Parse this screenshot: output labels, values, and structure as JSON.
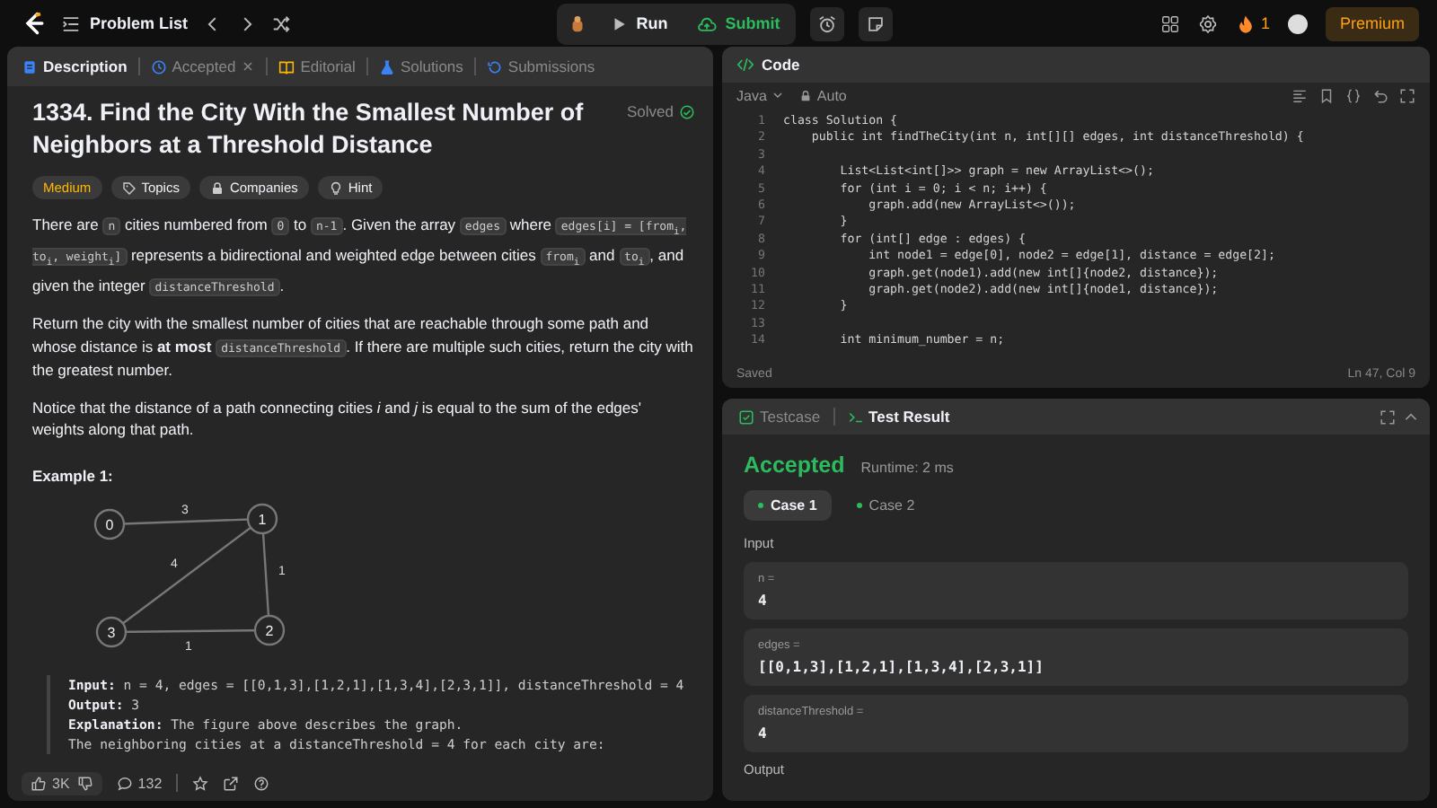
{
  "topbar": {
    "nav_title": "Problem List",
    "run_label": "Run",
    "submit_label": "Submit",
    "streak": "1",
    "premium": "Premium"
  },
  "description_panel": {
    "tabs": [
      {
        "label": "Description",
        "selected": true,
        "closable": false,
        "color": "#3c82f6"
      },
      {
        "label": "Accepted",
        "selected": false,
        "closable": true,
        "color": "#3c82f6"
      },
      {
        "label": "Editorial",
        "selected": false,
        "closable": false,
        "color": "#ffb700"
      },
      {
        "label": "Solutions",
        "selected": false,
        "closable": false,
        "color": "#3c82f6"
      },
      {
        "label": "Submissions",
        "selected": false,
        "closable": false,
        "color": "#3c82f6"
      }
    ],
    "title": "1334. Find the City With the Smallest Number of Neighbors at a Threshold Distance",
    "status": "Solved",
    "tags": [
      {
        "label": "Medium",
        "kind": "difficulty"
      },
      {
        "label": "Topics",
        "kind": "topics"
      },
      {
        "label": "Companies",
        "kind": "companies"
      },
      {
        "label": "Hint",
        "kind": "hint"
      }
    ],
    "paragraphs": [
      [
        {
          "kind": "text",
          "text": "There are "
        },
        {
          "kind": "code",
          "text": "n"
        },
        {
          "kind": "text",
          "text": " cities numbered from "
        },
        {
          "kind": "code",
          "text": "0"
        },
        {
          "kind": "text",
          "text": " to "
        },
        {
          "kind": "code",
          "text": "n-1"
        },
        {
          "kind": "text",
          "text": ". Given the array "
        },
        {
          "kind": "code",
          "text": "edges"
        },
        {
          "kind": "text",
          "text": " where "
        },
        {
          "kind": "code",
          "text": "edges[i] = [from$_{i}$, to$_{i}$, weight$_{i}$]"
        },
        {
          "kind": "text",
          "text": " represents a bidirectional and weighted edge between cities "
        },
        {
          "kind": "code",
          "text": "from$_{i}$"
        },
        {
          "kind": "text",
          "text": " and "
        },
        {
          "kind": "code",
          "text": "to$_{i}$"
        },
        {
          "kind": "text",
          "text": ", and given the integer "
        },
        {
          "kind": "code",
          "text": "distanceThreshold"
        },
        {
          "kind": "text",
          "text": "."
        }
      ],
      [
        {
          "kind": "text",
          "text": "Return the city with the smallest number of cities that are reachable through some path and whose distance is **at most** "
        },
        {
          "kind": "code",
          "text": "distanceThreshold"
        },
        {
          "kind": "text",
          "text": ". If there are multiple such cities, return the city with the greatest number."
        }
      ],
      [
        {
          "kind": "text",
          "text": "Notice that the distance of a path connecting cities *i* and *j* is equal to the sum of the edges' weights along that path."
        }
      ]
    ],
    "example_title": "Example 1:",
    "graph": {
      "nodes": [
        "0",
        "1",
        "3",
        "2"
      ],
      "edges": [
        {
          "weight": "3"
        },
        {
          "weight": "4"
        },
        {
          "weight": "1"
        },
        {
          "weight": "1"
        }
      ]
    },
    "example_lines": [
      "**Input:** n = 4, edges = [[0,1,3],[1,2,1],[1,3,4],[2,3,1]], distanceThreshold = 4",
      "**Output:** 3",
      "**Explanation:** The figure above describes the graph.",
      "The neighboring cities at a distanceThreshold = 4 for each city are:"
    ],
    "footer": {
      "likes": "3K",
      "comments": "132"
    }
  },
  "code_panel": {
    "title": "Code",
    "language": "Java",
    "mode": "Auto",
    "lines": [
      {
        "number": "1",
        "text": "class Solution {"
      },
      {
        "number": "2",
        "text": "    public int findTheCity(int n, int[][] edges, int distanceThreshold) {"
      },
      {
        "number": "3"
      },
      {
        "number": "4",
        "text": "        List<List<int[]>> graph = new ArrayList<>();"
      },
      {
        "number": "5",
        "text": "        for (int i = 0; i < n; i++) {"
      },
      {
        "number": "6",
        "text": "            graph.add(new ArrayList<>());"
      },
      {
        "number": "7",
        "text": "        }"
      },
      {
        "number": "8",
        "text": "        for (int[] edge : edges) {"
      },
      {
        "number": "9",
        "text": "            int node1 = edge[0], node2 = edge[1], distance = edge[2];"
      },
      {
        "number": "10",
        "text": "            graph.get(node1).add(new int[]{node2, distance});"
      },
      {
        "number": "11",
        "text": "            graph.get(node2).add(new int[]{node1, distance});"
      },
      {
        "number": "12",
        "text": "        }"
      },
      {
        "number": "13"
      },
      {
        "number": "14",
        "text": "        int minimum_number = n;"
      }
    ],
    "status": "Saved",
    "cursor": "Ln 47, Col 9"
  },
  "result_panel": {
    "tabs": [
      {
        "label": "Testcase",
        "selected": false
      },
      {
        "label": "Test Result",
        "selected": true
      }
    ],
    "verdict": "Accepted",
    "runtime": "Runtime: 2 ms",
    "cases": [
      {
        "label": "Case 1",
        "selected": true,
        "passed": true
      },
      {
        "label": "Case 2",
        "selected": false,
        "passed": true
      }
    ],
    "input_label": "Input",
    "inputs": [
      {
        "name": "n =",
        "value": "4"
      },
      {
        "name": "edges =",
        "value": "[[0,1,3],[1,2,1],[1,3,4],[2,3,1]]"
      },
      {
        "name": "distanceThreshold =",
        "value": "4"
      }
    ],
    "output_label": "Output"
  }
}
